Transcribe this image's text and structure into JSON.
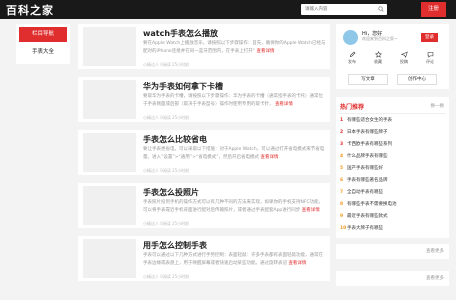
{
  "header": {
    "logo": "百科之家",
    "search_placeholder": "请输入内容",
    "register_label": "注册"
  },
  "sidebar": {
    "items": [
      {
        "label": "栏目导航",
        "active": true
      },
      {
        "label": "手表大全",
        "active": false
      }
    ]
  },
  "articles": [
    {
      "title": "watch手表怎么播放",
      "summary": "要在Apple Watch上播放音乐，请按照以下步骤操作：首先，确保你的Apple Watch已经与配对的iPhone连接并在同一蓝牙范围内，在手表上打开“",
      "more": "查看详情",
      "meta": "小精达人 0阅读 25小时前"
    },
    {
      "title": "华为手表如何拿下卡槽",
      "summary": "要取华为手表的卡槽，请按照以下步骤操作：华为手表的卡槽（通常指手表的卡托）通常位于手表侧面或后部（取决于手表型号）操作时使用专用的取卡针，",
      "more": "查看详情",
      "meta": "小精达人 0阅读 25小时前"
    },
    {
      "title": "手表怎么比较省电",
      "summary": "要让手表更省电，可以采取以下措施：对于Apple Watch，可以通过打开省电模式来节省电量。进入“设置”>“通用”>“省电模式”，然后开启省电模式",
      "more": "查看详情",
      "meta": "小精达人 0阅读 25小时前"
    },
    {
      "title": "手表怎么投照片",
      "summary": "手表照片投到手机的操作方式可以有几种不同的方法来实现，如果你的手机支持NFC功能，可以将手表靠近手机背面进行配对后传输照片，或者通过手表配套App进行同步",
      "more": "查看详情",
      "meta": "小精达人 0阅读 25小时前"
    },
    {
      "title": "用手怎么控制手表",
      "summary": "手表可以通过以下几种方式进行手势控制：表面轻敲：许多手表都有表面轻敲功能，通常在手表边缘或表盘上，用于唤醒屏幕或者快速启动某些功能。通过旋转表冠",
      "more": "查看详情",
      "meta": "小精达人 0阅读 25小时前"
    }
  ],
  "profile": {
    "greeting": "Hi，您好",
    "welcome": "欢迎来到百科之家~",
    "login_label": "登录",
    "actions": [
      {
        "label": "发布",
        "icon": "edit-icon"
      },
      {
        "label": "收藏",
        "icon": "star-icon"
      },
      {
        "label": "投稿",
        "icon": "send-icon"
      },
      {
        "label": "评论",
        "icon": "comment-icon"
      }
    ],
    "write_label": "写文章",
    "creator_label": "创作中心"
  },
  "hot": {
    "title": "热门推荐",
    "swap_label": "换一换",
    "items": [
      {
        "num": "1",
        "text": "有哪些适合女生的手表"
      },
      {
        "num": "2",
        "text": "日本手表有哪些牌子"
      },
      {
        "num": "3",
        "text": "卡西欧手表有哪些系列"
      },
      {
        "num": "4",
        "text": "什么品牌手表有哪些"
      },
      {
        "num": "5",
        "text": "国产手表有哪些好"
      },
      {
        "num": "6",
        "text": "手表有哪些著名品牌"
      },
      {
        "num": "7",
        "text": "全自动手表有哪些"
      },
      {
        "num": "8",
        "text": "有哪些手表不需要换电池"
      },
      {
        "num": "9",
        "text": "最近手表有哪些款式"
      },
      {
        "num": "10",
        "text": "手表大牌子有哪些"
      }
    ]
  },
  "more_boxes": [
    "查看更多",
    "查看更多"
  ],
  "colors": {
    "accent": "#e02d2d",
    "header_bg": "#191919",
    "page_bg": "#f3f3f3"
  }
}
